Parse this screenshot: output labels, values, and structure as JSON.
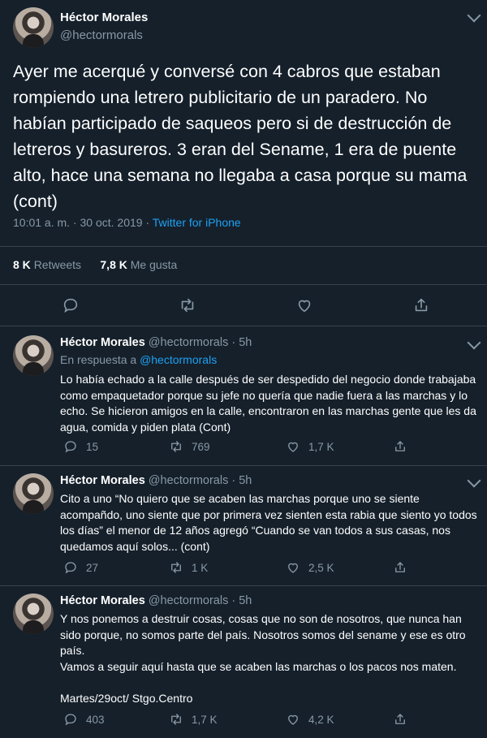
{
  "main": {
    "author_name": "Héctor Morales",
    "author_handle": "@hectormorals",
    "text": "Ayer me acerqué y conversé con 4 cabros que estaban rompiendo una letrero publicitario de un paradero. No habían participado de saqueos pero si de destrucción de letreros y basureros. 3 eran del Sename, 1 era de puente alto, hace una semana no llegaba a casa porque su mama (cont)",
    "time": "10:01 a. m.",
    "sep": "·",
    "date": "30 oct. 2019",
    "sep2": "·",
    "source": "Twitter for iPhone",
    "retweets_count": "8 K",
    "retweets_label": "Retweets",
    "likes_count": "7,8 K",
    "likes_label": "Me gusta"
  },
  "replies": [
    {
      "name": "Héctor Morales",
      "handle": "@hectormorals",
      "dot": "·",
      "age": "5h",
      "in_reply_prefix": "En respuesta a",
      "in_reply_handle": "@hectormorals",
      "text": "Lo había echado a la calle después de ser despedido del negocio donde trabajaba como empaquetador porque su jefe no quería que nadie fuera a las marchas y lo echo. Se hicieron amigos en la calle, encontraron en las marchas gente que les da agua, comida y piden plata (Cont)",
      "replies_count": "15",
      "retweets_count": "769",
      "likes_count": "1,7 K"
    },
    {
      "name": "Héctor Morales",
      "handle": "@hectormorals",
      "dot": "·",
      "age": "5h",
      "text": "Cito a uno “No quiero que se acaben  las marchas porque uno se siente acompañdo, uno siente que por primera vez sienten esta rabia que siento yo todos los días” el menor de 12 años agregó “Cuando se van todos a sus casas, nos quedamos aquí solos... (cont)",
      "replies_count": "27",
      "retweets_count": "1 K",
      "likes_count": "2,5 K"
    },
    {
      "name": "Héctor Morales",
      "handle": "@hectormorals",
      "dot": "·",
      "age": "5h",
      "text": "Y nos ponemos a destruir cosas, cosas que no son de nosotros, que nunca han sido porque, no somos parte del país. Nosotros somos del sename y ese es otro país.\nVamos a seguir aquí hasta que se acaben las marchas o los pacos nos maten.\n\nMartes/29oct/ Stgo.Centro",
      "replies_count": "403",
      "retweets_count": "1,7 K",
      "likes_count": "4,2 K"
    }
  ],
  "colors": {
    "background": "#15202b",
    "text": "#ffffff",
    "muted": "#8899a6",
    "accent": "#1da1f2",
    "divider": "#38444d"
  },
  "icons": [
    "reply-icon",
    "retweet-icon",
    "like-icon",
    "share-icon",
    "chevron-down-icon"
  ]
}
